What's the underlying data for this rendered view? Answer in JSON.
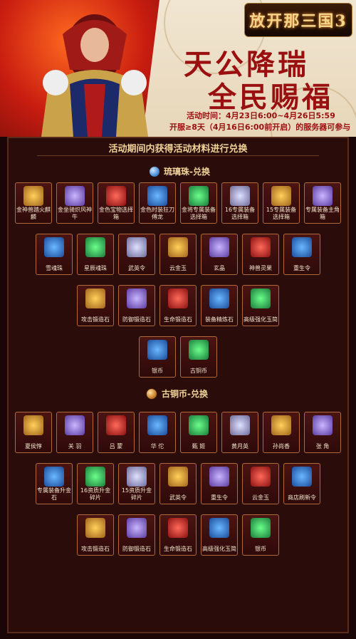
{
  "banner": {
    "logo": "放开那三国3",
    "title_line1": "天公降瑞",
    "title_line2": "全民赐福",
    "time_label": "活动时间：4月23日6:00~4月26日5:59",
    "server_label": "开服≥8天（4月16日6:00前开启）的服务器可参与"
  },
  "panel": {
    "heading": "活动期间内获得活动材料进行兑换"
  },
  "section1": {
    "title": "琉璃珠-兑换",
    "icon": "glass-bead-icon",
    "color": "#4a90d9"
  },
  "section2": {
    "title": "古铜币-兑换",
    "icon": "bronze-coin-icon",
    "color": "#c8822a"
  },
  "rows1": [
    [
      "金神兽踏火麒麟",
      "金坐骑炽风神牛",
      "金色宝物选择箱",
      "金色时装狂刀傅龙",
      "金将专属装备选择箱",
      "16专属装备选择箱",
      "15专属装备选择箱",
      "专属装备主角箱"
    ],
    [
      "雪魂珠",
      "星辰魂珠",
      "武英令",
      "云金玉",
      "玄晶",
      "神兽灵果",
      "重生令"
    ],
    [
      "攻击锻造石",
      "防御锻造石",
      "生命锻造石",
      "装备精炼石",
      "高级强化玉简"
    ],
    [
      "银币",
      "古铜币"
    ]
  ],
  "rows2": [
    [
      "夏侯惇",
      "关 羽",
      "吕 蒙",
      "华 佗",
      "甄 姬",
      "黄月英",
      "孙尚香",
      "张 角"
    ],
    [
      "专属装备升金石",
      "16资质升金碎片",
      "15资质升金碎片",
      "武英令",
      "重生令",
      "云金玉",
      "商店刷新令"
    ],
    [
      "攻击锻造石",
      "防御锻造石",
      "生命锻造石",
      "高级强化玉简",
      "银币"
    ]
  ],
  "colors": {
    "accent": "#9a1010",
    "frame": "#b06a3a",
    "gold": "#f0d398"
  }
}
